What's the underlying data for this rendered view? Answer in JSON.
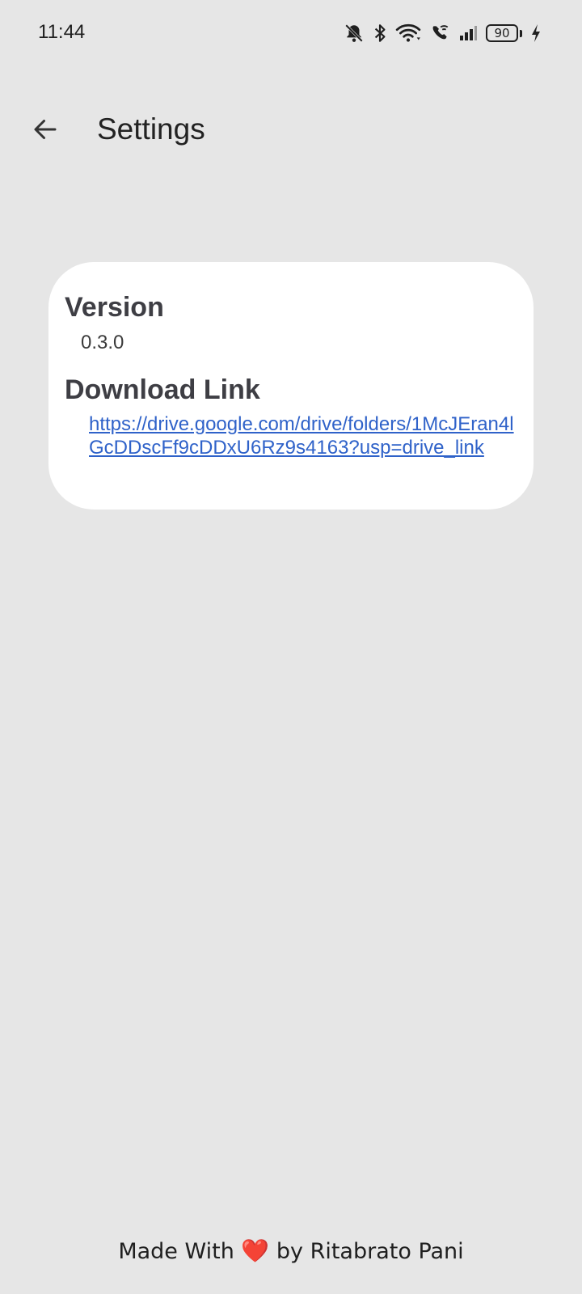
{
  "status_bar": {
    "time": "11:44",
    "battery_level": "90",
    "icons": [
      "bell-off-icon",
      "bluetooth-icon",
      "wifi-icon",
      "wifi-calling-icon",
      "signal-icon",
      "battery-icon",
      "charging-icon"
    ]
  },
  "app_bar": {
    "title": "Settings",
    "back_icon": "arrow-left-icon"
  },
  "card": {
    "version_heading": "Version",
    "version_value": "0.3.0",
    "download_heading": "Download Link",
    "download_url": "https://drive.google.com/drive/folders/1McJEran4lGcDDscFf9cDDxU6Rz9s4163?usp=drive_link"
  },
  "footer": {
    "prefix": "Made With",
    "heart": "❤️",
    "suffix": "by Ritabrato Pani"
  },
  "colors": {
    "background": "#e6e6e6",
    "card": "#ffffff",
    "link": "#2f62c9",
    "heading": "#3e3e44",
    "heart": "#e0302a"
  }
}
